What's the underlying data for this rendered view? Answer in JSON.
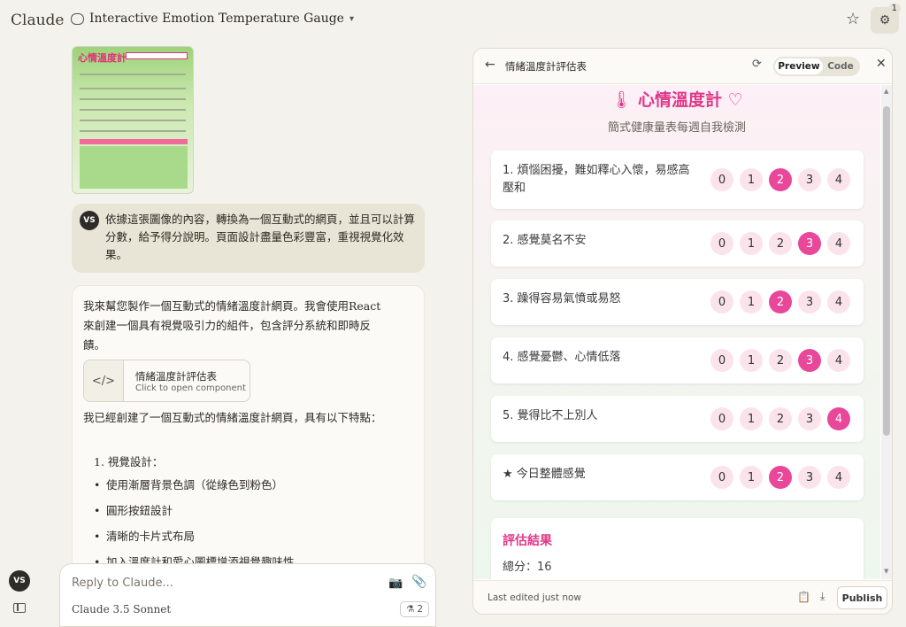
{
  "app": {
    "logo": "Claude"
  },
  "header": {
    "conversation_title": "Interactive Emotion Temperature Gauge",
    "settings_badge": "1"
  },
  "thumbnail": {
    "title": "心情溫度計"
  },
  "user_message": {
    "avatar": "VS",
    "text": "依據這張圖像的內容，轉換為一個互動式的網頁，並且可以計算分數，給予得分說明。頁面設計盡量色彩豐富，重視視覺化效果。"
  },
  "assistant_message": {
    "intro": "我來幫您製作一個互動式的情緒溫度計網頁。我會使用React來創建一個具有視覺吸引力的組件，包含評分系統和即時反饋。",
    "artifact": {
      "title": "情緒溫度計評估表",
      "subtitle": "Click to open component"
    },
    "summary": "我已經創建了一個互動式的情緒溫度計網頁，具有以下特點：",
    "section_1": "1. 視覺設計：",
    "bullets": [
      "使用漸層背景色調（從綠色到粉色）",
      "圓形按鈕設計",
      "清晰的卡片式布局",
      "加入溫度計和愛心圖標增添視覺趣味性"
    ]
  },
  "sidebar": {
    "user_avatar": "VS"
  },
  "composer": {
    "placeholder": "Reply to Claude...",
    "model": "Claude 3.5 Sonnet",
    "project_count": "2"
  },
  "panel": {
    "title": "情緒溫度計評估表",
    "toggle_preview": "Preview",
    "toggle_code": "Code",
    "footer_status": "Last edited just now",
    "publish_label": "Publish"
  },
  "preview": {
    "title": "心情溫度計",
    "subtitle": "簡式健康量表每週自我檢測",
    "questions": [
      {
        "text": "1. 煩惱困擾，難如釋心入懷，易感高壓和",
        "selected": 2
      },
      {
        "text": "2. 感覺莫名不安",
        "selected": 3
      },
      {
        "text": "3. 躁得容易氣憤或易怒",
        "selected": 2
      },
      {
        "text": "4. 感覺憂鬱、心情低落",
        "selected": 3
      },
      {
        "text": "5. 覺得比不上別人",
        "selected": 4
      },
      {
        "text": "★ 今日整體感覺",
        "selected": 2
      }
    ],
    "options": [
      "0",
      "1",
      "2",
      "3",
      "4"
    ],
    "result_title": "評估結果",
    "result_total": "總分：16"
  },
  "colors": {
    "accent_pink": "#e8479a",
    "option_bg": "#fbe3ec",
    "title_pink": "#e0388a"
  },
  "icons": [
    "chat-icon",
    "chevron-down-icon",
    "star-icon",
    "settings-icon",
    "code-icon",
    "camera-icon",
    "paperclip-icon",
    "back-arrow-icon",
    "refresh-icon",
    "close-icon",
    "thermometer-icon",
    "heart-icon",
    "clipboard-icon",
    "download-icon",
    "sidebar-toggle-icon"
  ]
}
